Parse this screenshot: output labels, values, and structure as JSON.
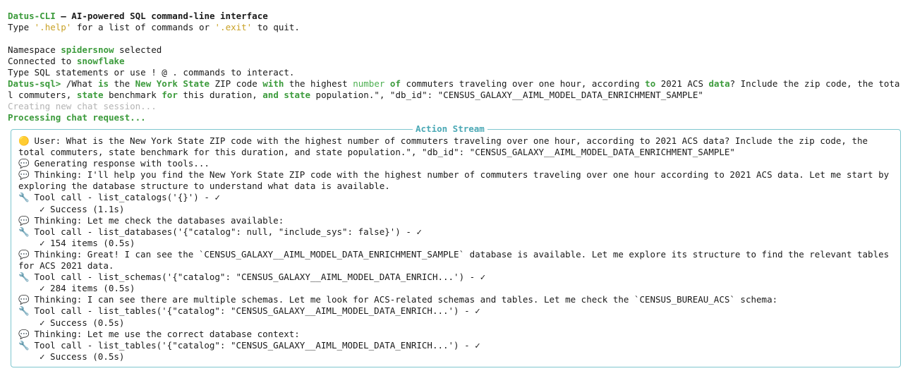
{
  "header": {
    "app_name": "Datus-CLI",
    "tagline": " – AI-powered SQL command-line interface",
    "help_line_pre": "Type ",
    "help_cmd": "'.help'",
    "help_line_mid": " for a list of commands or ",
    "exit_cmd": "'.exit'",
    "help_line_post": " to quit."
  },
  "session": {
    "namespace_pre": "Namespace ",
    "namespace": "spidersnow",
    "namespace_post": " selected",
    "connected_pre": "Connected to ",
    "connection": "snowflake",
    "hint": "Type SQL statements or use ! @ . commands to interact."
  },
  "prompt": {
    "label": "Datus-sql>",
    "line1_parts": [
      {
        "t": " /What ",
        "c": ""
      },
      {
        "t": "is",
        "c": "gb"
      },
      {
        "t": " the ",
        "c": ""
      },
      {
        "t": "New York State",
        "c": "gb"
      },
      {
        "t": " ZIP code ",
        "c": ""
      },
      {
        "t": "with",
        "c": "gb"
      },
      {
        "t": " the highest ",
        "c": ""
      },
      {
        "t": "number",
        "c": "g"
      },
      {
        "t": " ",
        "c": ""
      },
      {
        "t": "of",
        "c": "gb"
      },
      {
        "t": " commuters traveling over one hour, according ",
        "c": ""
      },
      {
        "t": "to",
        "c": "gb"
      },
      {
        "t": " 2021 ACS ",
        "c": ""
      },
      {
        "t": "data",
        "c": "gb"
      },
      {
        "t": "? Include the zip code, the tota",
        "c": ""
      }
    ],
    "line2_parts": [
      {
        "t": "l commuters, ",
        "c": ""
      },
      {
        "t": "state",
        "c": "gb"
      },
      {
        "t": " benchmark ",
        "c": ""
      },
      {
        "t": "for",
        "c": "gb"
      },
      {
        "t": " this duration, ",
        "c": ""
      },
      {
        "t": "and",
        "c": "gb"
      },
      {
        "t": " ",
        "c": ""
      },
      {
        "t": "state",
        "c": "gb"
      },
      {
        "t": " population.\", \"db_id\": \"CENSUS_GALAXY__AIML_MODEL_DATA_ENRICHMENT_SAMPLE\"",
        "c": ""
      }
    ]
  },
  "status": {
    "creating": "Creating new chat session...",
    "processing": "Processing chat request..."
  },
  "panel": {
    "title": "Action Stream",
    "border_color": "#7fc7cf",
    "entries": [
      {
        "icon": "🟡",
        "icon_name": "yellow-circle-icon",
        "text": "User: What is the New York State ZIP code with the highest number of commuters traveling over one hour, according to 2021 ACS data? Include the zip code, the",
        "cont": "total commuters, state benchmark for this duration, and state population.\", \"db_id\": \"CENSUS_GALAXY__AIML_MODEL_DATA_ENRICHMENT_SAMPLE\""
      },
      {
        "icon": "💬",
        "icon_name": "speech-bubble-icon",
        "text": "Generating response with tools..."
      },
      {
        "icon": "💬",
        "icon_name": "speech-bubble-icon",
        "text": "Thinking: I'll help you find the New York State ZIP code with the highest number of commuters traveling over one hour according to 2021 ACS data. Let me start by",
        "cont": "exploring the database structure to understand what data is available."
      },
      {
        "icon": "🔧",
        "icon_name": "wrench-icon",
        "text": "Tool call - list_catalogs('{}') - ✓",
        "result": "✓ Success (1.1s)"
      },
      {
        "icon": "💬",
        "icon_name": "speech-bubble-icon",
        "text": "Thinking: Let me check the databases available:"
      },
      {
        "icon": "🔧",
        "icon_name": "wrench-icon",
        "text": "Tool call - list_databases('{\"catalog\": null, \"include_sys\": false}') - ✓",
        "result": "✓ 154 items (0.5s)"
      },
      {
        "icon": "💬",
        "icon_name": "speech-bubble-icon",
        "text": "Thinking: Great! I can see the `CENSUS_GALAXY__AIML_MODEL_DATA_ENRICHMENT_SAMPLE` database is available. Let me explore its structure to find the relevant tables",
        "cont": "for ACS 2021 data."
      },
      {
        "icon": "🔧",
        "icon_name": "wrench-icon",
        "text": "Tool call - list_schemas('{\"catalog\": \"CENSUS_GALAXY__AIML_MODEL_DATA_ENRICH...') - ✓",
        "result": "✓ 284 items (0.5s)"
      },
      {
        "icon": "💬",
        "icon_name": "speech-bubble-icon",
        "text": "Thinking: I can see there are multiple schemas. Let me look for ACS-related schemas and tables. Let me check the `CENSUS_BUREAU_ACS` schema:"
      },
      {
        "icon": "🔧",
        "icon_name": "wrench-icon",
        "text": "Tool call - list_tables('{\"catalog\": \"CENSUS_GALAXY__AIML_MODEL_DATA_ENRICH...') - ✓",
        "result": "✓ Success (0.5s)"
      },
      {
        "icon": "💬",
        "icon_name": "speech-bubble-icon",
        "text": "Thinking: Let me use the correct database context:"
      },
      {
        "icon": "🔧",
        "icon_name": "wrench-icon",
        "text": "Tool call - list_tables('{\"catalog\": \"CENSUS_GALAXY__AIML_MODEL_DATA_ENRICH...') - ✓",
        "result": "✓ Success (0.5s)"
      }
    ]
  }
}
